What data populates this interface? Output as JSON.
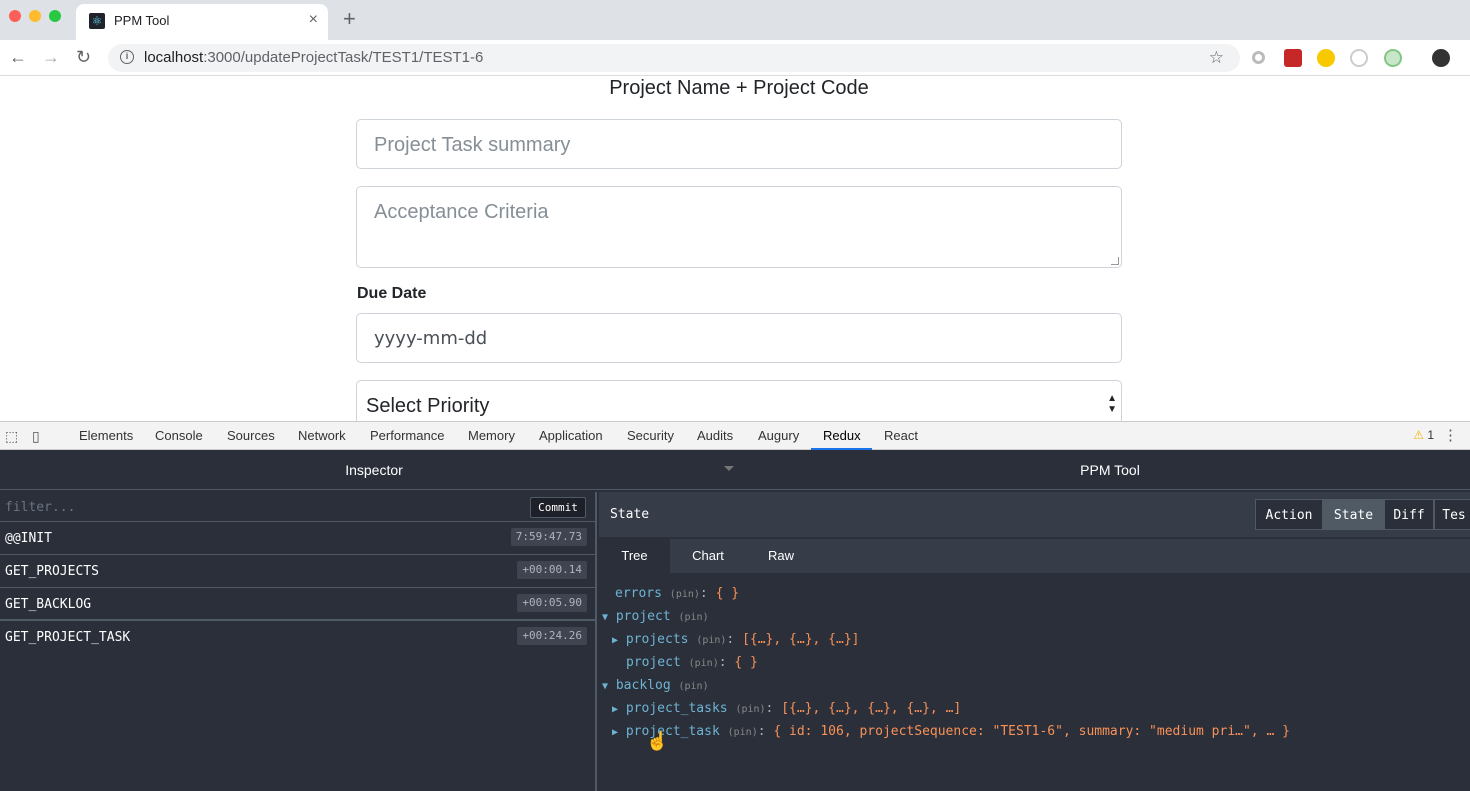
{
  "browser": {
    "tab_title": "PPM Tool",
    "tab_close": "×",
    "new_tab": "+",
    "url_host": "localhost",
    "url_path": ":3000/updateProjectTask/TEST1/TEST1-6"
  },
  "form": {
    "title": "Project Name + Project Code",
    "summary_placeholder": "Project Task summary",
    "criteria_placeholder": "Acceptance Criteria",
    "due_date_label": "Due Date",
    "due_date_placeholder": "yyyy-mm-dd",
    "priority_selected": "Select Priority"
  },
  "devtools": {
    "tabs": [
      "Elements",
      "Console",
      "Sources",
      "Network",
      "Performance",
      "Memory",
      "Application",
      "Security",
      "Audits",
      "Augury",
      "Redux",
      "React"
    ],
    "active_tab": "Redux",
    "warning_count": "1"
  },
  "redux": {
    "header_left": "Inspector",
    "header_right": "PPM Tool",
    "filter_placeholder": "filter...",
    "commit_label": "Commit",
    "actions": [
      {
        "name": "@@INIT",
        "time": "7:59:47.73"
      },
      {
        "name": "GET_PROJECTS",
        "time": "+00:00.14"
      },
      {
        "name": "GET_BACKLOG",
        "time": "+00:05.90"
      },
      {
        "name": "GET_PROJECT_TASK",
        "time": "+00:24.26"
      }
    ],
    "state_title": "State",
    "segments": [
      "Action",
      "State",
      "Diff",
      "Tes"
    ],
    "active_segment": "State",
    "subtabs": [
      "Tree",
      "Chart",
      "Raw"
    ],
    "active_subtab": "Tree",
    "tree": [
      {
        "key": "errors",
        "pin": "(pin)",
        "value": "{ }",
        "expander": ""
      },
      {
        "key": "project",
        "pin": "(pin)",
        "value": "",
        "expander": "▼"
      },
      {
        "key": "projects",
        "pin": "(pin)",
        "value": "[{…}, {…}, {…}]",
        "expander": "▶"
      },
      {
        "key": "project",
        "pin": "(pin)",
        "value": "{ }",
        "expander": ""
      },
      {
        "key": "backlog",
        "pin": "(pin)",
        "value": "",
        "expander": "▼"
      },
      {
        "key": "project_tasks",
        "pin": "(pin)",
        "value": "[{…}, {…}, {…}, {…}, …]",
        "expander": "▶"
      },
      {
        "key": "project_task",
        "pin": "(pin)",
        "value": "{ id: 106, projectSequence: \"TEST1-6\", summary: \"medium pri…\", … }",
        "expander": "▶"
      }
    ]
  }
}
